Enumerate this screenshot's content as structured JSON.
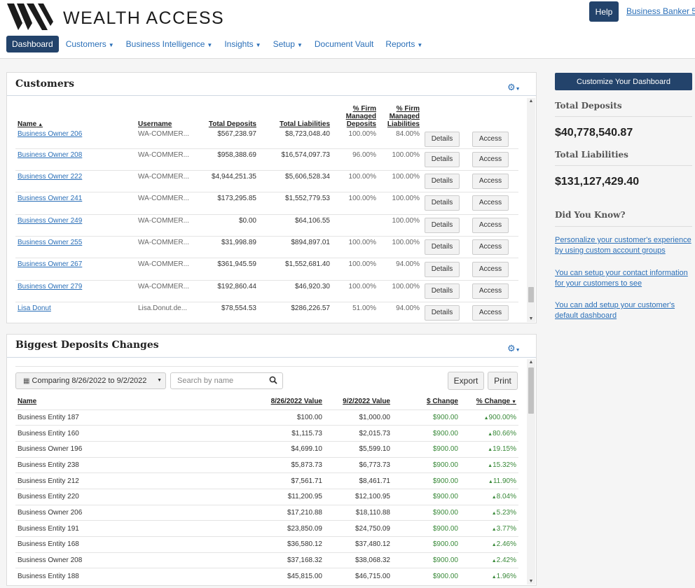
{
  "app": {
    "brand": "WEALTH ACCESS",
    "help_label": "Help",
    "user_label": "Business Banker 5"
  },
  "nav": [
    {
      "label": "Dashboard",
      "has_caret": false
    },
    {
      "label": "Customers",
      "has_caret": true
    },
    {
      "label": "Business Intelligence",
      "has_caret": true
    },
    {
      "label": "Insights",
      "has_caret": true
    },
    {
      "label": "Setup",
      "has_caret": true
    },
    {
      "label": "Document Vault",
      "has_caret": false
    },
    {
      "label": "Reports",
      "has_caret": true
    }
  ],
  "customers": {
    "title": "Customers",
    "columns": {
      "name": "Name",
      "username": "Username",
      "deposits": "Total Deposits",
      "liabilities": "Total Liabilities",
      "firm_deposits": "% Firm Managed Deposits",
      "firm_liabilities": "% Firm Managed Liabilities"
    },
    "details_label": "Details",
    "access_label": "Access",
    "rows": [
      {
        "name": "Business Owner 206",
        "username": "WA-COMMER...",
        "deposits": "$567,238.97",
        "liabilities": "$8,723,048.40",
        "firm_deposits": "100.00%",
        "firm_liabilities": "84.00%"
      },
      {
        "name": "Business Owner 208",
        "username": "WA-COMMER...",
        "deposits": "$958,388.69",
        "liabilities": "$16,574,097.73",
        "firm_deposits": "96.00%",
        "firm_liabilities": "100.00%"
      },
      {
        "name": "Business Owner 222",
        "username": "WA-COMMER...",
        "deposits": "$4,944,251.35",
        "liabilities": "$5,606,528.34",
        "firm_deposits": "100.00%",
        "firm_liabilities": "100.00%"
      },
      {
        "name": "Business Owner 241",
        "username": "WA-COMMER...",
        "deposits": "$173,295.85",
        "liabilities": "$1,552,779.53",
        "firm_deposits": "100.00%",
        "firm_liabilities": "100.00%"
      },
      {
        "name": "Business Owner 249",
        "username": "WA-COMMER...",
        "deposits": "$0.00",
        "liabilities": "$64,106.55",
        "firm_deposits": "",
        "firm_liabilities": "100.00%"
      },
      {
        "name": "Business Owner 255",
        "username": "WA-COMMER...",
        "deposits": "$31,998.89",
        "liabilities": "$894,897.01",
        "firm_deposits": "100.00%",
        "firm_liabilities": "100.00%"
      },
      {
        "name": "Business Owner 267",
        "username": "WA-COMMER...",
        "deposits": "$361,945.59",
        "liabilities": "$1,552,681.40",
        "firm_deposits": "100.00%",
        "firm_liabilities": "94.00%"
      },
      {
        "name": "Business Owner 279",
        "username": "WA-COMMER...",
        "deposits": "$192,860.44",
        "liabilities": "$46,920.30",
        "firm_deposits": "100.00%",
        "firm_liabilities": "100.00%"
      },
      {
        "name": "Lisa Donut",
        "username": "Lisa.Donut.de...",
        "deposits": "$78,554.53",
        "liabilities": "$286,226.57",
        "firm_deposits": "51.00%",
        "firm_liabilities": "94.00%"
      }
    ]
  },
  "deposits": {
    "title": "Biggest Deposits Changes",
    "date_range": "Comparing  8/26/2022 to 9/2/2022",
    "search_placeholder": "Search by name",
    "export_label": "Export",
    "print_label": "Print",
    "columns": {
      "name": "Name",
      "before": "8/26/2022 Value",
      "after": "9/2/2022 Value",
      "change": "$ Change",
      "pct": "% Change"
    },
    "rows": [
      {
        "name": "Business Entity 187",
        "before": "$100.00",
        "after": "$1,000.00",
        "change": "$900.00",
        "pct": "900.00%"
      },
      {
        "name": "Business Entity 160",
        "before": "$1,115.73",
        "after": "$2,015.73",
        "change": "$900.00",
        "pct": "80.66%"
      },
      {
        "name": "Business Owner 196",
        "before": "$4,699.10",
        "after": "$5,599.10",
        "change": "$900.00",
        "pct": "19.15%"
      },
      {
        "name": "Business Entity 238",
        "before": "$5,873.73",
        "after": "$6,773.73",
        "change": "$900.00",
        "pct": "15.32%"
      },
      {
        "name": "Business Entity 212",
        "before": "$7,561.71",
        "after": "$8,461.71",
        "change": "$900.00",
        "pct": "11.90%"
      },
      {
        "name": "Business Entity 220",
        "before": "$11,200.95",
        "after": "$12,100.95",
        "change": "$900.00",
        "pct": "8.04%"
      },
      {
        "name": "Business Owner 206",
        "before": "$17,210.88",
        "after": "$18,110.88",
        "change": "$900.00",
        "pct": "5.23%"
      },
      {
        "name": "Business Entity 191",
        "before": "$23,850.09",
        "after": "$24,750.09",
        "change": "$900.00",
        "pct": "3.77%"
      },
      {
        "name": "Business Entity 168",
        "before": "$36,580.12",
        "after": "$37,480.12",
        "change": "$900.00",
        "pct": "2.46%"
      },
      {
        "name": "Business Owner 208",
        "before": "$37,168.32",
        "after": "$38,068.32",
        "change": "$900.00",
        "pct": "2.42%"
      },
      {
        "name": "Business Entity 188",
        "before": "$45,815.00",
        "after": "$46,715.00",
        "change": "$900.00",
        "pct": "1.96%"
      }
    ]
  },
  "sidebar": {
    "customize_label": "Customize Your Dashboard",
    "total_deposits_label": "Total Deposits",
    "total_deposits_value": "$40,778,540.87",
    "total_liabilities_label": "Total Liabilities",
    "total_liabilities_value": "$131,127,429.40",
    "did_you_know_label": "Did You Know?",
    "tips": [
      "Personalize your customer's experience by using custom account groups",
      "You can setup your contact information for your customers to see",
      "You can add setup your customer's default dashboard"
    ]
  },
  "colors": {
    "brand_navy": "#23436b",
    "link_blue": "#2a6fb8",
    "positive_green": "#3a8a3a"
  }
}
